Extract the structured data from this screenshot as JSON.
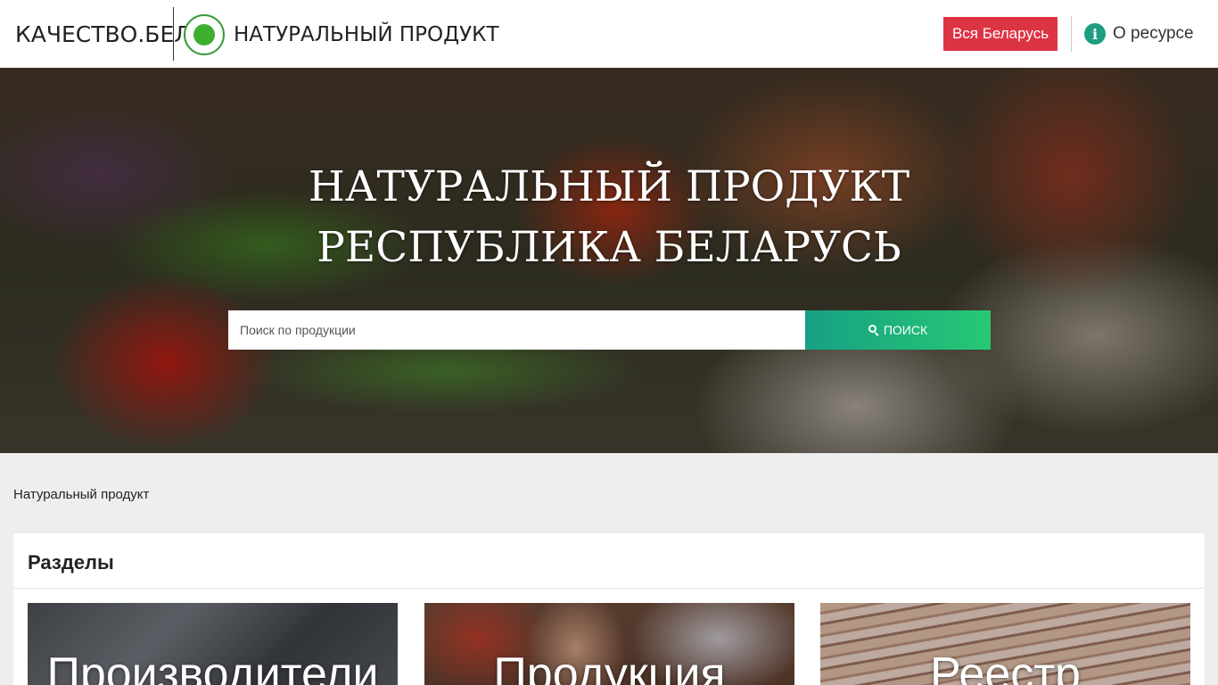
{
  "header": {
    "brand": "КАЧЕСТВО.БЕЛ",
    "product_name": "НАТУРАЛЬНЫЙ ПРОДУКТ",
    "region_button": "Вся Беларусь",
    "about_label": "О ресурсе",
    "colors": {
      "region_button": "#dd3444",
      "info_icon": "#1f9d83",
      "logo_green": "#3eae2f"
    }
  },
  "hero": {
    "title_line1": "НАТУРАЛЬНЫЙ ПРОДУКТ",
    "title_line2": "РЕСПУБЛИКА БЕЛАРУСЬ",
    "search": {
      "placeholder": "Поиск по продукции",
      "value": "",
      "button_label": "ПОИСК",
      "icon": "search-icon"
    }
  },
  "breadcrumb": "Натуральный продукт",
  "sections": {
    "title": "Разделы",
    "tiles": [
      {
        "label": "Производители"
      },
      {
        "label": "Продукция"
      },
      {
        "label": "Реестр"
      }
    ]
  }
}
